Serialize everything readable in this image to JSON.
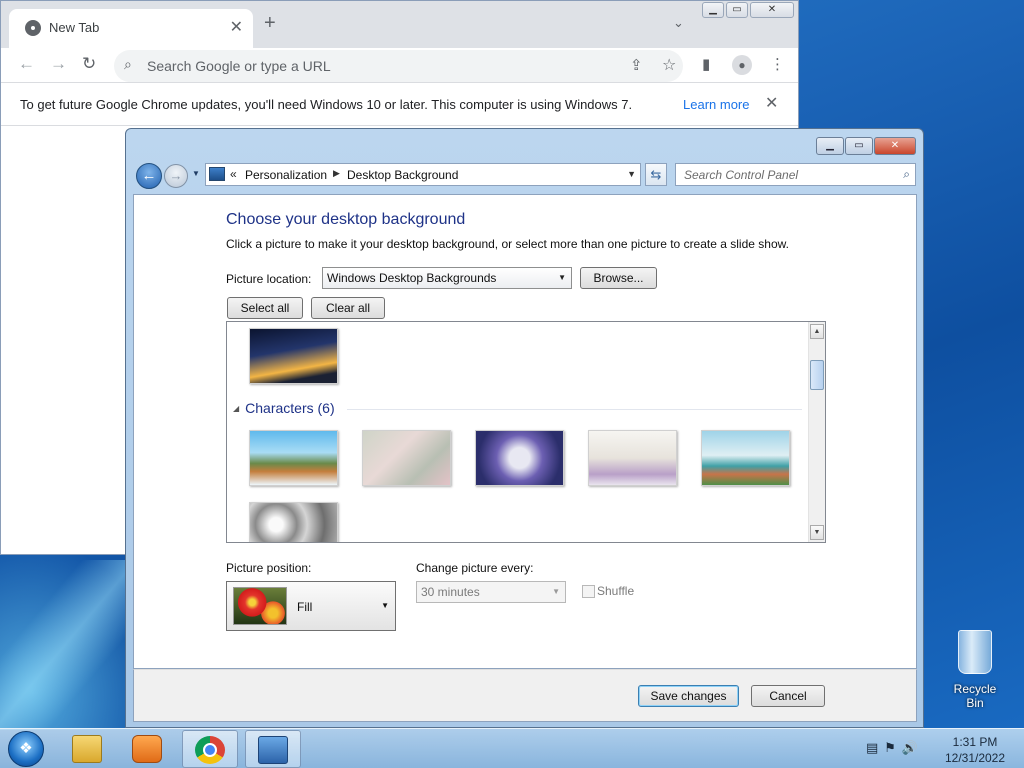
{
  "chrome": {
    "tab_title": "New Tab",
    "tab_close": "✕",
    "new_tab": "+",
    "tab_search_chevron": "⌄",
    "win_minimize": "▁",
    "win_maximize": "▭",
    "win_close": "✕",
    "back": "←",
    "forward": "→",
    "reload": "↻",
    "omnibox_placeholder": "Search Google or type a URL",
    "share": "⇪",
    "bookmark": "☆",
    "side_panel": "▮",
    "profile": "●",
    "menu": "⋮",
    "infobar_text": "To get future Google Chrome updates, you'll need Windows 10 or later. This computer is using Windows 7.",
    "infobar_link": "Learn more",
    "infobar_close": "✕"
  },
  "control_panel": {
    "back": "←",
    "forward": "→",
    "history_dropdown": "▼",
    "address_prefix": "«",
    "breadcrumb": [
      "Personalization",
      "Desktop Background"
    ],
    "breadcrumb_sep": "▶",
    "address_dropdown": "▼",
    "refresh": "⇆",
    "search_placeholder": "Search Control Panel",
    "search_icon": "⌕",
    "win_minimize": "▁",
    "win_maximize": "▭",
    "win_close": "✕",
    "heading": "Choose your desktop background",
    "subheading": "Click a picture to make it your desktop background, or select more than one picture to create a slide show.",
    "picture_location_label": "Picture location:",
    "picture_location_value": "Windows Desktop Backgrounds",
    "browse_button": "Browse...",
    "select_all_button": "Select all",
    "clear_all_button": "Clear all",
    "group_title": "Characters (6)",
    "group_toggle": "◢",
    "picture_position_label": "Picture position:",
    "picture_position_value": "Fill",
    "change_picture_label": "Change picture every:",
    "change_picture_value": "30 minutes",
    "shuffle_label": "Shuffle",
    "save_button": "Save changes",
    "cancel_button": "Cancel",
    "scroll_up": "▲",
    "scroll_down": "▼",
    "dropdown_arrow": "▼"
  },
  "desktop": {
    "recycle_bin_label": "Recycle Bin"
  },
  "taskbar": {
    "start": "❖",
    "tray_icons": "▤⚑🔊",
    "time": "1:31 PM",
    "date": "12/31/2022"
  }
}
